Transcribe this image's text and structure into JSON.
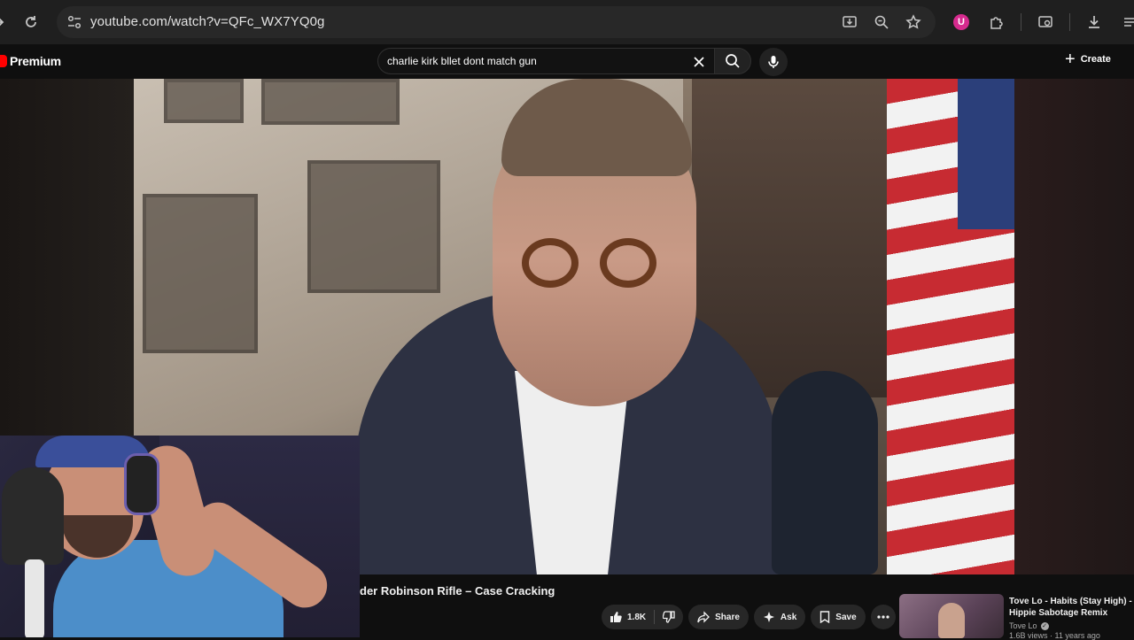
{
  "browser": {
    "url": "youtube.com/watch?v=QFc_WX7YQ0g",
    "extension_badge": "U"
  },
  "youtube": {
    "logo_text": "Premium",
    "search": {
      "query": "charlie kirk bllet dont match gun"
    },
    "create_label": "Create"
  },
  "video": {
    "title": "der Robinson Rifle – Case Cracking",
    "actions": {
      "like_count": "1.8K",
      "share_label": "Share",
      "ask_label": "Ask",
      "save_label": "Save"
    }
  },
  "recommendation": {
    "title": "Tove Lo - Habits (Stay High) - Hippie Sabotage Remix",
    "channel": "Tove Lo",
    "meta": "1.6B views · 11 years ago"
  },
  "colors": {
    "youtube_red": "#ff0000",
    "background": "#0f0f0f",
    "chrome": "#1f1f1f"
  }
}
